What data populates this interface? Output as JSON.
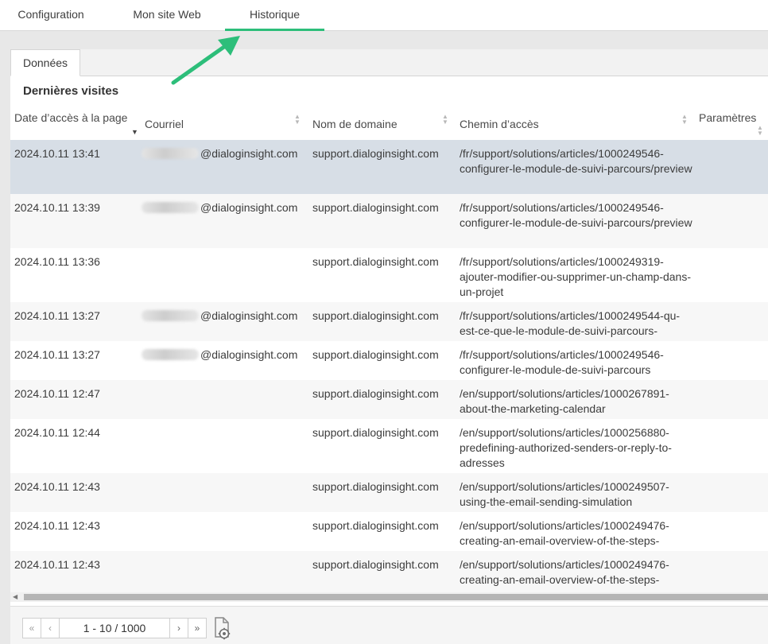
{
  "tabs": [
    {
      "label": "Configuration"
    },
    {
      "label": "Mon site Web"
    },
    {
      "label": "Historique"
    }
  ],
  "panel": {
    "tab_label": "Données",
    "section_title": "Dernières visites"
  },
  "table": {
    "columns": {
      "date": "Date d’accès à la page",
      "email": "Courriel",
      "domain": "Nom de domaine",
      "path": "Chemin d’accès",
      "params": "Paramètres"
    },
    "rows": [
      {
        "date": "2024.10.11 13:41",
        "email": "@dialoginsight.com",
        "domain": "support.dialoginsight.com",
        "path": "/fr/support/solutions/articles/1000249546-configurer-le-module-de-suivi-parcours/preview"
      },
      {
        "date": "2024.10.11 13:39",
        "email": "@dialoginsight.com",
        "domain": "support.dialoginsight.com",
        "path": "/fr/support/solutions/articles/1000249546-configurer-le-module-de-suivi-parcours/preview"
      },
      {
        "date": "2024.10.11 13:36",
        "email": "",
        "domain": "support.dialoginsight.com",
        "path": "/fr/support/solutions/articles/1000249319-ajouter-modifier-ou-supprimer-un-champ-dans-un-projet"
      },
      {
        "date": "2024.10.11 13:27",
        "email": "@dialoginsight.com",
        "domain": "support.dialoginsight.com",
        "path": "/fr/support/solutions/articles/1000249544-qu-est-ce-que-le-module-de-suivi-parcours-"
      },
      {
        "date": "2024.10.11 13:27",
        "email": "@dialoginsight.com",
        "domain": "support.dialoginsight.com",
        "path": "/fr/support/solutions/articles/1000249546-configurer-le-module-de-suivi-parcours"
      },
      {
        "date": "2024.10.11 12:47",
        "email": "",
        "domain": "support.dialoginsight.com",
        "path": "/en/support/solutions/articles/1000267891-about-the-marketing-calendar"
      },
      {
        "date": "2024.10.11 12:44",
        "email": "",
        "domain": "support.dialoginsight.com",
        "path": "/en/support/solutions/articles/1000256880-predefining-authorized-senders-or-reply-to-adresses"
      },
      {
        "date": "2024.10.11 12:43",
        "email": "",
        "domain": "support.dialoginsight.com",
        "path": "/en/support/solutions/articles/1000249507-using-the-email-sending-simulation"
      },
      {
        "date": "2024.10.11 12:43",
        "email": "",
        "domain": "support.dialoginsight.com",
        "path": "/en/support/solutions/articles/1000249476-creating-an-email-overview-of-the-steps-"
      },
      {
        "date": "2024.10.11 12:43",
        "email": "",
        "domain": "support.dialoginsight.com",
        "path": "/en/support/solutions/articles/1000249476-creating-an-email-overview-of-the-steps-"
      }
    ]
  },
  "pager": {
    "first": "«",
    "prev": "‹",
    "info": "1 - 10 / 1000",
    "next": "›",
    "last": "»"
  },
  "colors": {
    "accent": "#2dbe7a",
    "selected_row": "#d7dee6"
  },
  "icons": {
    "export": "export-settings-icon",
    "annotation": "arrow-annotation-icon"
  }
}
